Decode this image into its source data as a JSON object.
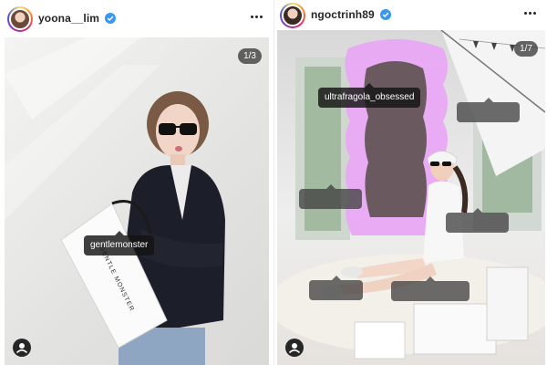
{
  "posts": [
    {
      "username": "yoona__lim",
      "verified": true,
      "carousel_counter": "1/3",
      "product_tags": [
        {
          "label": "gentlemonster"
        }
      ],
      "bag_text": "GENTLE MONSTER"
    },
    {
      "username": "ngoctrinh89",
      "verified": true,
      "carousel_counter": "1/7",
      "product_tags": [
        {
          "label": "ultrafragola_obsessed"
        },
        {
          "label": ""
        },
        {
          "label": ""
        },
        {
          "label": ""
        },
        {
          "label": ""
        },
        {
          "label": ""
        }
      ]
    }
  ],
  "colors": {
    "verified_blue": "#3897f0",
    "mirror_pink": "#e8a8f4",
    "tag_bg": "#141414"
  },
  "icons": {
    "more": "more-options-icon",
    "verified": "verified-badge-icon",
    "user_tag": "user-tag-icon"
  }
}
